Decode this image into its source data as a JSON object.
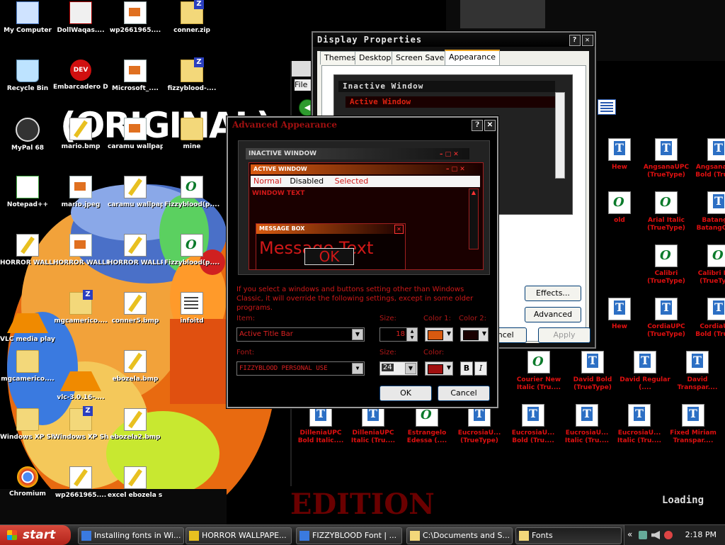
{
  "desktop_icons": [
    {
      "label": "My Computer",
      "icon": "computer-icon"
    },
    {
      "label": "DollWaqas....",
      "icon": "web-icon"
    },
    {
      "label": "wp2661965....",
      "icon": "image-icon"
    },
    {
      "label": "conner.zip",
      "icon": "zip-icon"
    },
    {
      "label": "Recycle Bin",
      "icon": "recycle-bin-icon"
    },
    {
      "label": "Embarcadero Dev-C++",
      "icon": "dev-cpp-icon"
    },
    {
      "label": "Microsoft_....",
      "icon": "image-icon"
    },
    {
      "label": "fizzyblood-....",
      "icon": "zip-icon"
    },
    {
      "label": "MyPal 68",
      "icon": "browser-icon"
    },
    {
      "label": "mario.bmp",
      "icon": "paint-icon"
    },
    {
      "label": "caramu wallpaper....",
      "icon": "image-icon"
    },
    {
      "label": "mine",
      "icon": "folder-icon"
    },
    {
      "label": "Notepad++",
      "icon": "notepad-plus-icon"
    },
    {
      "label": "mario.jpeg",
      "icon": "image-icon"
    },
    {
      "label": "caramu wallpaper....",
      "icon": "paint-icon"
    },
    {
      "label": "Fizzyblood(p....",
      "icon": "font-icon"
    },
    {
      "label": "HORROR WALLPAPE....",
      "icon": "paint-icon"
    },
    {
      "label": "HORROR WALLPAPE....",
      "icon": "image-icon"
    },
    {
      "label": "HORROR WALLPAP....",
      "icon": "paint-icon"
    },
    {
      "label": "Fizzyblood(p....",
      "icon": "font-icon"
    },
    {
      "label": "VLC media player",
      "icon": "vlc-icon"
    },
    {
      "label": "mgcamerico....",
      "icon": "zip-icon"
    },
    {
      "label": "conner5.bmp",
      "icon": "paint-icon"
    },
    {
      "label": "infoitd",
      "icon": "text-file-icon"
    },
    {
      "label": "mgcamerico....",
      "icon": "folder-icon"
    },
    {
      "label": "vlc-3.0.16-....",
      "icon": "vlc-icon"
    },
    {
      "label": "ebozela.bmp",
      "icon": "paint-icon"
    },
    {
      "label": "Windows XP Shipping Tool",
      "icon": "folder-icon"
    },
    {
      "label": "Windows XP Shipping....",
      "icon": "zip-icon"
    },
    {
      "label": "ebozela2.bmp",
      "icon": "paint-icon"
    },
    {
      "label": "Chromium",
      "icon": "chromium-icon"
    },
    {
      "label": "wp2661965....",
      "icon": "paint-icon"
    },
    {
      "label": "excel ebozela smoking.o....",
      "icon": "paint-icon"
    }
  ],
  "fonts_window": {
    "menu_file": "File",
    "fonts": [
      {
        "label": "Hew",
        "icon": "font-t-icon"
      },
      {
        "label": "AngsanaUPC (TrueType)",
        "icon": "font-t-icon"
      },
      {
        "label": "AngsanaUPC Bold (True....",
        "icon": "font-t-icon"
      },
      {
        "label": "old",
        "icon": "font-o-icon"
      },
      {
        "label": "Arial Italic (TrueType)",
        "icon": "font-o-icon"
      },
      {
        "label": "Batang & BatangCh....",
        "icon": "font-t-icon"
      },
      {
        "label": "Calibri (TrueType)",
        "icon": "font-o-icon"
      },
      {
        "label": "Calibri Bold (TrueType)",
        "icon": "font-o-icon"
      },
      {
        "label": "Hew",
        "icon": "font-t-icon"
      },
      {
        "label": "CordiaUPC (TrueType)",
        "icon": "font-t-icon"
      },
      {
        "label": "CordiaUPC Bold (True....",
        "icon": "font-t-icon"
      },
      {
        "label": "Courier New Italic (Tru....",
        "icon": "font-o-icon"
      },
      {
        "label": "David Bold (TrueType)",
        "icon": "font-t-icon"
      },
      {
        "label": "David Regular (....",
        "icon": "font-t-icon"
      },
      {
        "label": "David Transpar....",
        "icon": "font-t-icon"
      },
      {
        "label": "DilleniaUPC Bold Italic....",
        "icon": "font-t-icon"
      },
      {
        "label": "DilleniaUPC Italic (Tru....",
        "icon": "font-t-icon"
      },
      {
        "label": "Estrangelo Edessa (....",
        "icon": "font-o-icon"
      },
      {
        "label": "EucrosiaU... (TrueType)",
        "icon": "font-t-icon"
      },
      {
        "label": "EucrosiaU... Bold (Tru....",
        "icon": "font-t-icon"
      },
      {
        "label": "EucrosiaU... Italic (Tru....",
        "icon": "font-t-icon"
      },
      {
        "label": "EucrosiaU... Italic (Tru....",
        "icon": "font-t-icon"
      },
      {
        "label": "Fixed Miriam Transpar....",
        "icon": "font-t-icon"
      }
    ]
  },
  "display_properties": {
    "title": "Display Properties",
    "tabs": [
      "Themes",
      "Desktop",
      "Screen Saver",
      "Appearance"
    ],
    "active_tab": "Appearance",
    "preview_inactive": "Inactive Window",
    "preview_active": "Active Window",
    "effects_button": "Effects...",
    "advanced_button": "Advanced",
    "cancel_button": "Cancel",
    "apply_button": "Apply"
  },
  "advanced_appearance": {
    "title": "Advanced Appearance",
    "preview": {
      "inactive_window": "INACTIVE WINDOW",
      "active_window": "ACTIVE WINDOW",
      "menu_normal": "Normal",
      "menu_disabled": "Disabled",
      "menu_selected": "Selected",
      "window_text": "WINDOW TEXT",
      "message_box": "MESSAGE BOX",
      "message_text": "Message Text",
      "ok": "OK"
    },
    "info_text": "If you select a windows and buttons setting other than Windows Classic, it will override the following settings, except in some older programs.",
    "item_label": "Item:",
    "item_value": "Active Title Bar",
    "size_label": "Size:",
    "size_value": "18",
    "color1_label": "Color 1:",
    "color1_hex": "#d85a10",
    "color2_label": "Color 2:",
    "color2_hex": "#1a0000",
    "font_label": "Font:",
    "font_value": "FIZZYBLOOD PERSONAL USE",
    "font_size_label": "Size:",
    "font_size_value": "24",
    "font_color_label": "Color:",
    "font_color_hex": "#a01010",
    "bold_button": "B",
    "italic_button": "I",
    "ok_button": "OK",
    "cancel_button": "Cancel"
  },
  "background": {
    "original_text": "(ORIGINAL)",
    "edition_text": "EDITION",
    "loading_text": "Loading"
  },
  "taskbar": {
    "start_label": "start",
    "items": [
      {
        "label": "Installing fonts in Wi...",
        "icon": "browser-icon"
      },
      {
        "label": "HORROR WALLPAPE...",
        "icon": "paint-icon"
      },
      {
        "label": "FIZZYBLOOD Font | ...",
        "icon": "browser-icon"
      },
      {
        "label": "C:\\Documents and S...",
        "icon": "zip-icon"
      },
      {
        "label": "Fonts",
        "icon": "folder-icon"
      }
    ],
    "active_item": "Fonts",
    "clock": "2:18 PM"
  }
}
